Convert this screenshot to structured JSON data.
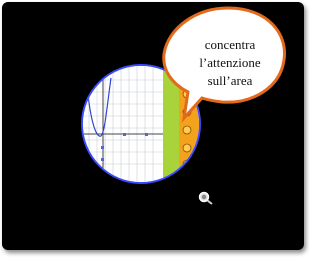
{
  "callout": {
    "lines": [
      "concentra",
      "l’attenzione",
      "sull’area"
    ]
  },
  "colors": {
    "background": "#000000",
    "lens_border": "#3b4cff",
    "toolbar_green": "#a9d33a",
    "toolbar_orange": "#f3a21c",
    "callout_border": "#e46a1b",
    "curve": "#3344cc"
  },
  "icons": {
    "cursor": "magnifier-cursor-icon"
  }
}
